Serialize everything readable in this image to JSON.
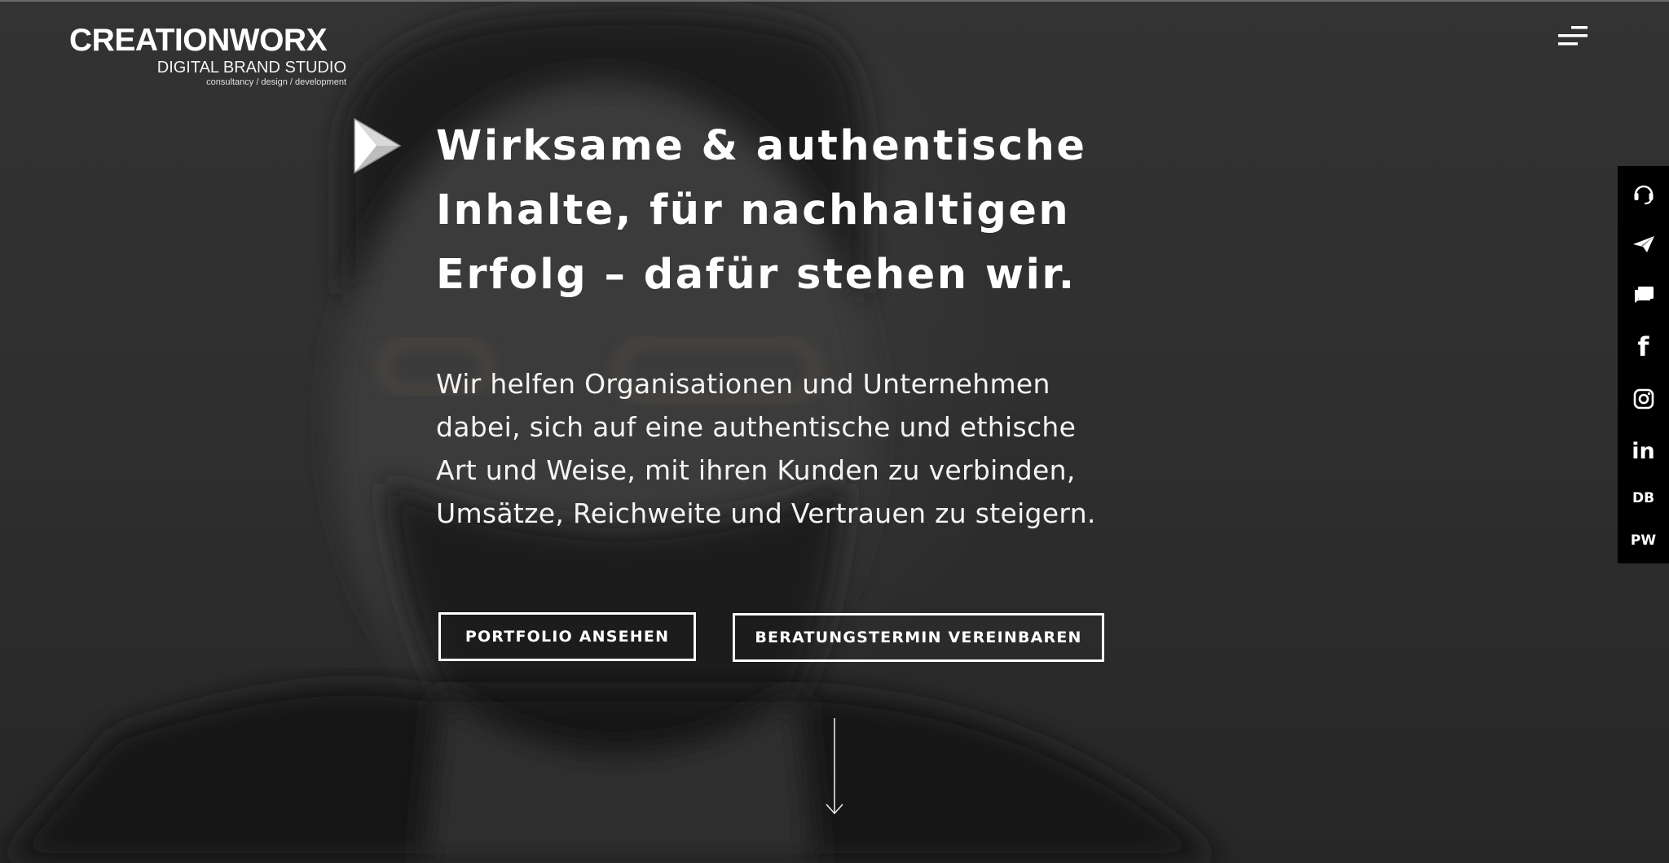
{
  "brand": {
    "name": "CREATIONWORX",
    "tagline": "DIGITAL BRAND STUDIO",
    "subline": "consultancy / design / development"
  },
  "nav": {
    "menu_icon": "hamburger-menu-icon"
  },
  "hero": {
    "headline_lines": [
      "Wirksame & authentische",
      "Inhalte, für nachhaltigen",
      "Erfolg – dafür stehen wir."
    ],
    "lead_lines": [
      "Wir helfen Organisationen und Unternehmen",
      "dabei, sich auf eine authentische und ethische",
      "Art und Weise, mit ihren Kunden zu verbinden,",
      "Umsätze, Reichweite und Vertrauen zu steigern."
    ],
    "buttons": {
      "portfolio": "PORTFOLIO ANSEHEN",
      "consultation": "BERATUNGSTERMIN VEREINBAREN"
    },
    "scroll_icon": "arrow-down-icon",
    "play_icon": "play-triangle-icon"
  },
  "social_bar": {
    "items": [
      {
        "icon": "headset-icon"
      },
      {
        "icon": "paper-plane-icon"
      },
      {
        "icon": "chat-icon"
      },
      {
        "icon": "facebook-icon"
      },
      {
        "icon": "instagram-icon"
      },
      {
        "icon": "linkedin-icon"
      },
      {
        "icon": "text-badge",
        "label": "DB"
      },
      {
        "icon": "text-badge",
        "label": "PW"
      }
    ]
  },
  "colors": {
    "background": "#2b2b2b",
    "text": "#ffffff",
    "social_bar": "#000000"
  }
}
